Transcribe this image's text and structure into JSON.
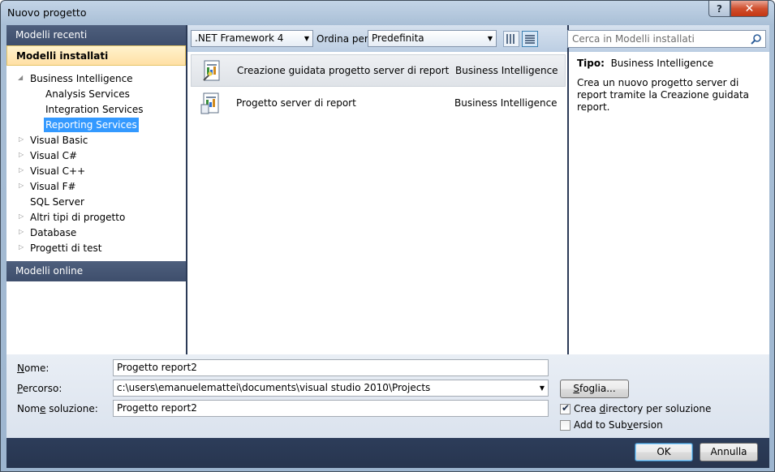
{
  "window": {
    "title": "Nuovo progetto",
    "help_glyph": "?",
    "close_glyph": "✕"
  },
  "left_panel": {
    "recent": "Modelli recenti",
    "installed": "Modelli installati",
    "online": "Modelli online",
    "tree": [
      {
        "label": "Business Intelligence",
        "expanded": true
      },
      {
        "label": "Analysis Services"
      },
      {
        "label": "Integration Services"
      },
      {
        "label": "Reporting Services",
        "selected": true
      },
      {
        "label": "Visual Basic"
      },
      {
        "label": "Visual C#"
      },
      {
        "label": "Visual C++"
      },
      {
        "label": "Visual F#"
      },
      {
        "label": "SQL Server"
      },
      {
        "label": "Altri tipi di progetto"
      },
      {
        "label": "Database"
      },
      {
        "label": "Progetti di test"
      }
    ]
  },
  "toolbar": {
    "framework": ".NET Framework 4",
    "sort_label": "Ordina per:",
    "sort_value": "Predefinita"
  },
  "templates": [
    {
      "name": "Creazione guidata progetto server di report",
      "category": "Business Intelligence",
      "selected": true
    },
    {
      "name": "Progetto server di report",
      "category": "Business Intelligence"
    }
  ],
  "info": {
    "search_placeholder": "Cerca in Modelli installati",
    "type_label": "Tipo:",
    "type_value": "Business Intelligence",
    "description": "Crea un nuovo progetto server di report tramite la Creazione guidata report."
  },
  "form": {
    "name_label_u": "N",
    "name_label_rest": "ome:",
    "name_value": "Progetto report2",
    "path_label_u": "P",
    "path_label_rest": "ercorso:",
    "path_value": "c:\\users\\emanuelemattei\\documents\\visual studio 2010\\Projects",
    "solution_label_pre": "Nom",
    "solution_label_u": "e",
    "solution_label_rest": " soluzione:",
    "solution_value": "Progetto report2",
    "browse_u": "S",
    "browse_rest": "foglia...",
    "create_dir_pre": "Crea ",
    "create_dir_u": "d",
    "create_dir_rest": "irectory per soluzione",
    "create_dir_checked": true,
    "subversion_pre": "Add to Sub",
    "subversion_u": "v",
    "subversion_rest": "ersion",
    "subversion_checked": false
  },
  "buttons": {
    "ok": "OK",
    "cancel": "Annulla"
  }
}
